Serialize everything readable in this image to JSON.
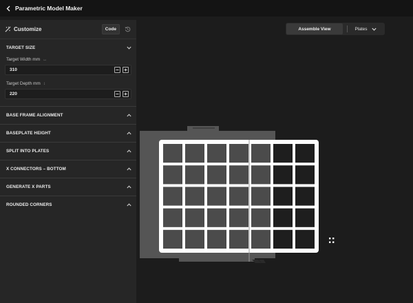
{
  "header": {
    "title": "Parametric Model Maker",
    "back_icon": "chevron-left-icon"
  },
  "sidebar": {
    "title": "Customize",
    "code_label": "Code",
    "sections": {
      "target_size": {
        "title": "TARGET SIZE",
        "width_label": "Target Width mm",
        "width_hint": "↔",
        "width_value": "310",
        "depth_label": "Target Depth mm",
        "depth_hint": "↕",
        "depth_value": "220"
      },
      "base_frame_alignment": "BASE FRAME ALIGNMENT",
      "baseplate_height": "BASEPLATE HEIGHT",
      "split_into_plates": "SPLIT INTO PLATES",
      "x_connectors_bottom": "X CONNECTORS – BOTTOM",
      "generate_x_parts": "GENERATE X PARTS",
      "rounded_corners": "ROUNDED CORNERS"
    }
  },
  "view": {
    "assemble_label": "Assemble View",
    "plates_label": "Plates"
  },
  "model": {
    "columns": 7,
    "rows": 5,
    "colors": {
      "plate": "#555555",
      "frame": "#ffffff",
      "cell": "#4b4b4b",
      "cell_dark": "#1e1e1e"
    }
  }
}
